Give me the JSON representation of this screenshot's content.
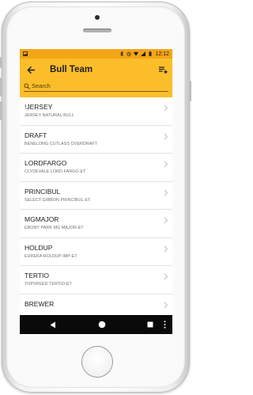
{
  "statusbar": {
    "time": "12:12"
  },
  "header": {
    "title": "Bull Team"
  },
  "search": {
    "placeholder": "Search"
  },
  "bulls": [
    {
      "name": "!JERSEY",
      "fullname": "JERSEY NATURAL BULL"
    },
    {
      "name": "DRAFT",
      "fullname": "BENELONG CUTLASS OVERDRAFT"
    },
    {
      "name": "LORDFARGO",
      "fullname": "CLYDEVALE LORD FARGO-ET"
    },
    {
      "name": "PRINCIBUL",
      "fullname": "SELECT GIBBON PRINCIBUL-ET"
    },
    {
      "name": "MGMAJOR",
      "fullname": "EBONY PARK MG MAJOR-ET"
    },
    {
      "name": "HOLDUP",
      "fullname": "EUREKA HOLDUP-IMP-ET"
    },
    {
      "name": "TERTIO",
      "fullname": "TOPSPEED TERTIO-ET"
    },
    {
      "name": "BREWER",
      "fullname": ""
    }
  ],
  "colors": {
    "appbar": "#fbbe2a",
    "statusbar": "#f3a516",
    "navbar": "#0a0a0a"
  },
  "icons": {
    "back": "arrow-left-icon",
    "menu": "playlist-add-icon",
    "search": "search-icon",
    "chevron": "chevron-right-icon"
  }
}
